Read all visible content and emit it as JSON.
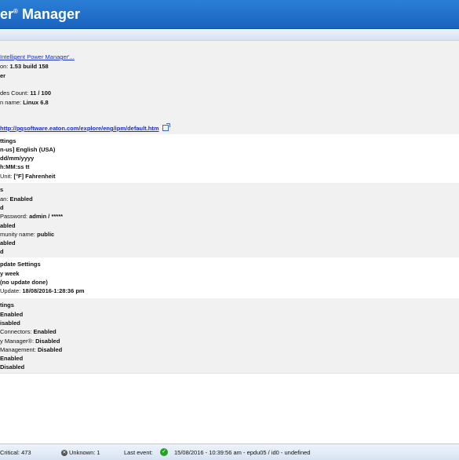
{
  "header": {
    "title_part1": "wer",
    "title_sup": "®",
    "title_part2": " Manager"
  },
  "about": {
    "product_link": "Intelligent Power Manager'...",
    "version_label": "on:",
    "version_value": "1.53 build 158",
    "line3": "er",
    "nodes_label": "des Count:",
    "nodes_value": "11 / 100",
    "os_label": "n name:",
    "os_value": "Linux 6.8",
    "url": "http://pqsoftware.eaton.com/explore/eng/ipm/default.htm"
  },
  "regional": {
    "title": "ttings",
    "language": "n-us] English (USA)",
    "date_format": "dd/mm/yyyy",
    "time_format": "h:MM:ss tt",
    "temp_label": "Unit:",
    "temp_value": "[°F] Fahrenheit"
  },
  "network": {
    "title": "s",
    "l1_label": "an:",
    "l1_value": "Enabled",
    "l2": "d",
    "l3_label": "Password:",
    "l3_value": "admin / *****",
    "l4": "abled",
    "l5_label": "munity name:",
    "l5_value": "public",
    "l6": "abled",
    "l7": "d"
  },
  "update": {
    "title": "pdate Settings",
    "l1": "y week",
    "l2": "(no update done)",
    "l3_label": "Update:",
    "l3_value": "18/08/2016-1:28:36 pm"
  },
  "modules": {
    "title": "tings",
    "l1": "Enabled",
    "l2": "isabled",
    "l3_label": "Connectors:",
    "l3_value": "Enabled",
    "l4_label": "y Manager®:",
    "l4_value": "Disabled",
    "l5_label": "Management:",
    "l5_value": "Disabled",
    "l6": "Enabled",
    "l7": "Disabled"
  },
  "statusbar": {
    "critical": "Critical: 473",
    "unknown": "Unknown: 1",
    "last_event_label": "Last event:",
    "last_event_value": "15/08/2016 - 10:39:56 am - epdu05 / id0 - undefined"
  },
  "colors": {
    "header": "#1a63bf",
    "ok": "#23a123",
    "link": "#1a2fcf"
  }
}
